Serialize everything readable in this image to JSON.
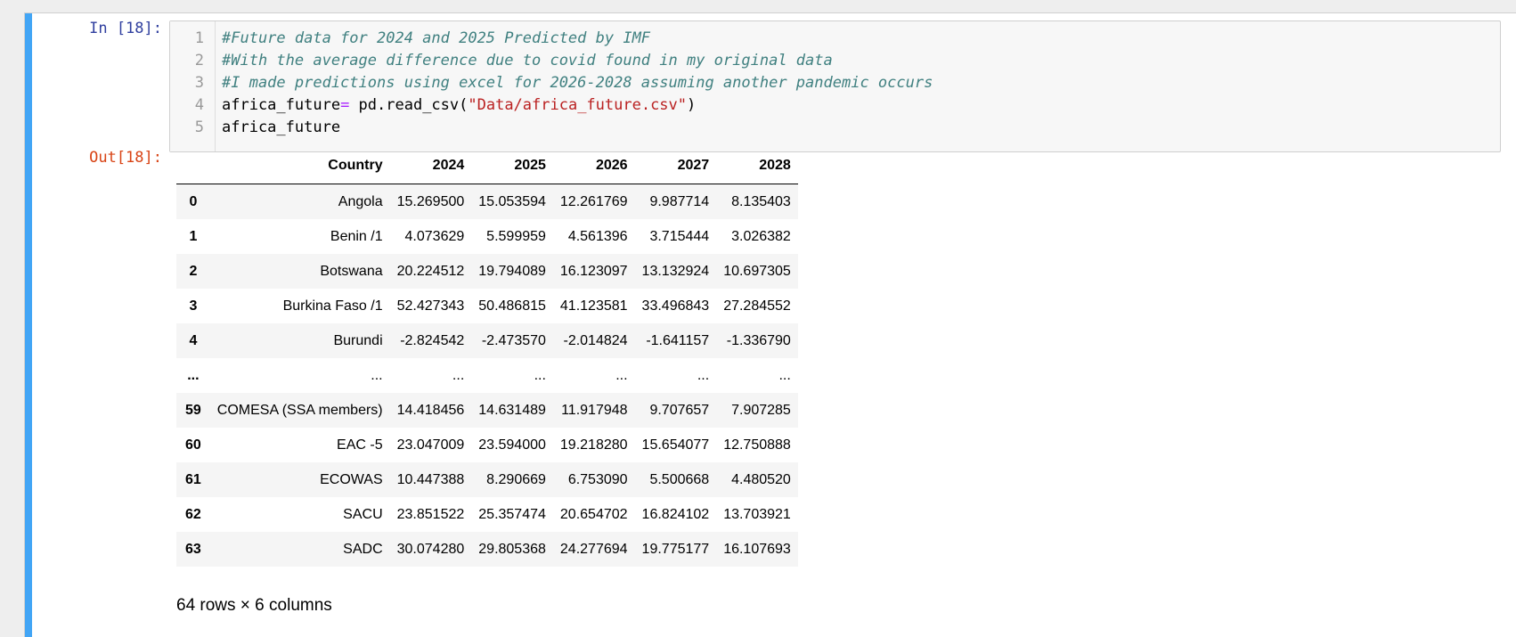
{
  "input_prompt": "In [18]:",
  "output_prompt": "Out[18]:",
  "code": [
    {
      "num": "1",
      "parts": [
        {
          "t": "#Future data for 2024 and 2025 Predicted by IMF",
          "c": "comment"
        }
      ]
    },
    {
      "num": "2",
      "parts": [
        {
          "t": "#With the average difference due to covid found in my original data",
          "c": "comment"
        }
      ]
    },
    {
      "num": "3",
      "parts": [
        {
          "t": "#I made predictions using excel for 2026-2028 assuming another pandemic occurs",
          "c": "comment"
        }
      ]
    },
    {
      "num": "4",
      "parts": [
        {
          "t": "africa_future",
          "c": ""
        },
        {
          "t": "=",
          "c": "op"
        },
        {
          "t": " pd.read_csv(",
          "c": ""
        },
        {
          "t": "\"Data/africa_future.csv\"",
          "c": "str"
        },
        {
          "t": ")",
          "c": ""
        }
      ]
    },
    {
      "num": "5",
      "parts": [
        {
          "t": "africa_future",
          "c": ""
        }
      ]
    }
  ],
  "table": {
    "columns": [
      "",
      "Country",
      "2024",
      "2025",
      "2026",
      "2027",
      "2028"
    ],
    "rows": [
      [
        "0",
        "Angola",
        "15.269500",
        "15.053594",
        "12.261769",
        "9.987714",
        "8.135403"
      ],
      [
        "1",
        "Benin /1",
        "4.073629",
        "5.599959",
        "4.561396",
        "3.715444",
        "3.026382"
      ],
      [
        "2",
        "Botswana",
        "20.224512",
        "19.794089",
        "16.123097",
        "13.132924",
        "10.697305"
      ],
      [
        "3",
        "Burkina Faso /1",
        "52.427343",
        "50.486815",
        "41.123581",
        "33.496843",
        "27.284552"
      ],
      [
        "4",
        "Burundi",
        "-2.824542",
        "-2.473570",
        "-2.014824",
        "-1.641157",
        "-1.336790"
      ],
      [
        "...",
        "...",
        "...",
        "...",
        "...",
        "...",
        "..."
      ],
      [
        "59",
        "COMESA (SSA members)",
        "14.418456",
        "14.631489",
        "11.917948",
        "9.707657",
        "7.907285"
      ],
      [
        "60",
        "EAC -5",
        "23.047009",
        "23.594000",
        "19.218280",
        "15.654077",
        "12.750888"
      ],
      [
        "61",
        "ECOWAS",
        "10.447388",
        "8.290669",
        "6.753090",
        "5.500668",
        "4.480520"
      ],
      [
        "62",
        "SACU",
        "23.851522",
        "25.357474",
        "20.654702",
        "16.824102",
        "13.703921"
      ],
      [
        "63",
        "SADC",
        "30.074280",
        "29.805368",
        "24.277694",
        "19.775177",
        "16.107693"
      ]
    ]
  },
  "shape_note": "64 rows × 6 columns",
  "colors": {
    "selection_bar": "#42a5f5",
    "in_prompt": "#303f9f",
    "out_prompt": "#d84315",
    "comment": "#408080",
    "string": "#ba2121",
    "operator": "#aa22ff"
  }
}
